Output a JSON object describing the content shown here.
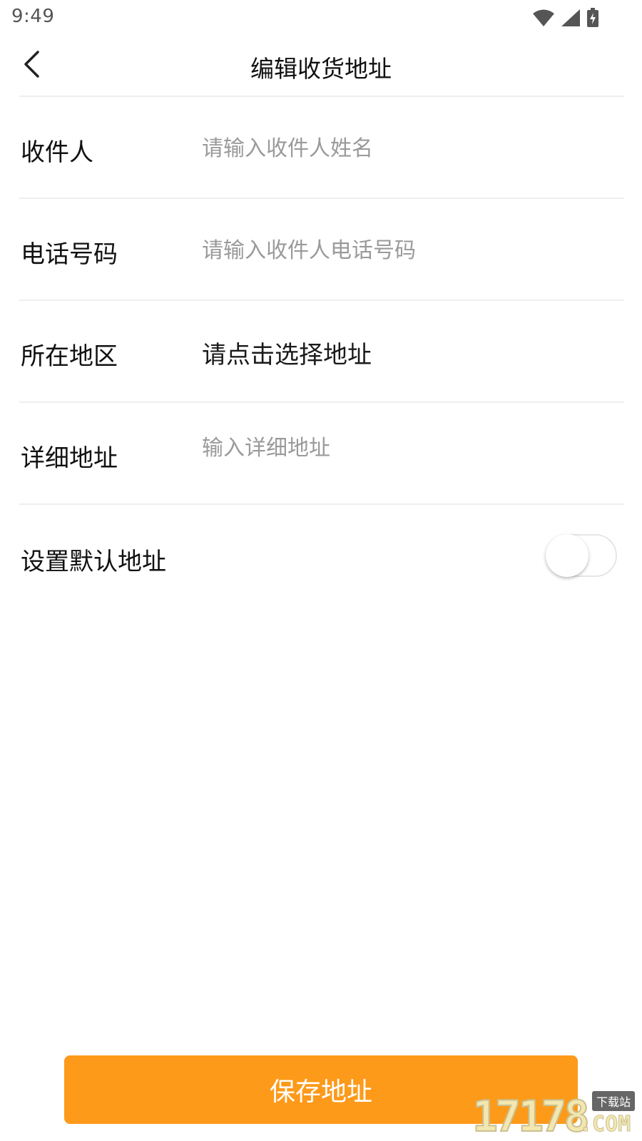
{
  "status_bar": {
    "time": "9:49",
    "icons": [
      "wifi-icon",
      "signal-icon",
      "battery-charging-icon"
    ]
  },
  "header": {
    "title": "编辑收货地址",
    "back_icon": "chevron-left-icon"
  },
  "form": {
    "recipient": {
      "label": "收件人",
      "value": "",
      "placeholder": "请输入收件人姓名"
    },
    "phone": {
      "label": "电话号码",
      "value": "",
      "placeholder": "请输入收件人电话号码"
    },
    "region": {
      "label": "所在地区",
      "value": "请点击选择地址"
    },
    "detail": {
      "label": "详细地址",
      "value": "",
      "placeholder": "输入详细地址"
    },
    "default_address": {
      "label": "设置默认地址",
      "enabled": false
    }
  },
  "save_button": {
    "label": "保存地址",
    "color": "#fd9a1a"
  },
  "watermark": {
    "digits": "17178",
    "suffix": ".COM",
    "tag": "下载站"
  },
  "colors": {
    "accent": "#fd9a1a",
    "divider": "#eeeeee",
    "placeholder": "#9a9a9a"
  }
}
